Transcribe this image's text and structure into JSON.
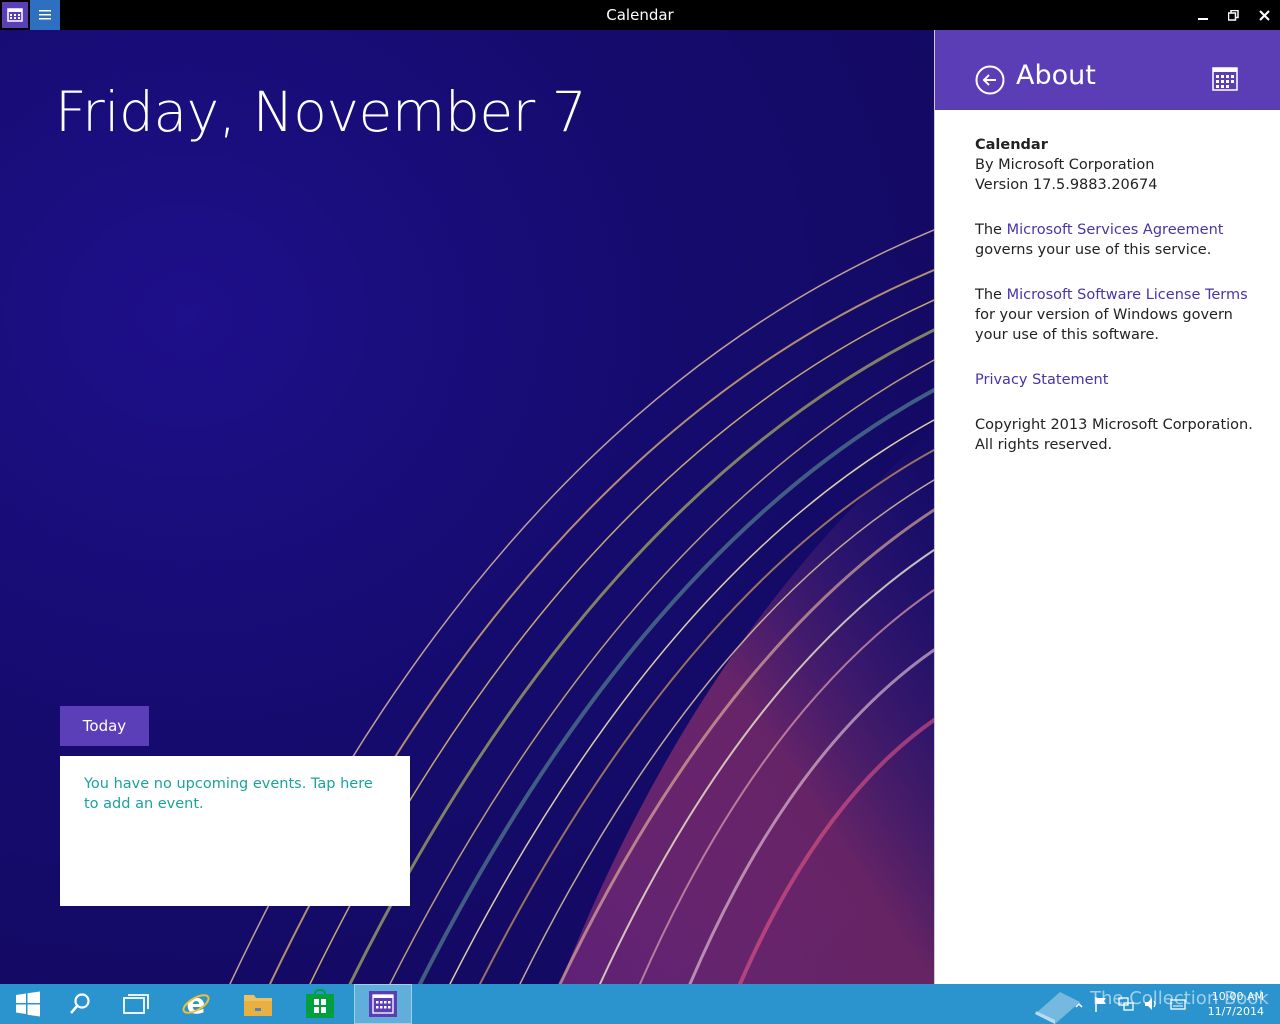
{
  "titlebar": {
    "title": "Calendar"
  },
  "main": {
    "date_heading": "Friday, November 7",
    "today_label": "Today",
    "no_events_text": "You have no upcoming events. Tap here to add an event."
  },
  "about": {
    "title": "About",
    "app_name": "Calendar",
    "publisher": "By Microsoft Corporation",
    "version": "Version 17.5.9883.20674",
    "msa_prefix": "The ",
    "msa_link": "Microsoft Services Agreement",
    "msa_suffix": "governs your use of this service.",
    "license_prefix": "The ",
    "license_link": "Microsoft Software License Terms",
    "license_suffix": "for your version of Windows govern your use of this software.",
    "privacy_link": "Privacy Statement",
    "copyright_line1": "Copyright 2013 Microsoft Corporation.",
    "copyright_line2": "All rights reserved."
  },
  "taskbar": {
    "items": [
      "start",
      "search",
      "task-view",
      "internet-explorer",
      "file-explorer",
      "store",
      "calendar"
    ],
    "clock_time": "10:00 AM",
    "clock_date": "11/7/2014"
  },
  "watermark": "The Collection Book",
  "colors": {
    "accent": "#5b3eb6",
    "link": "#4a34a8",
    "event_text": "#1ba399",
    "taskbar": "#2b94cf"
  }
}
